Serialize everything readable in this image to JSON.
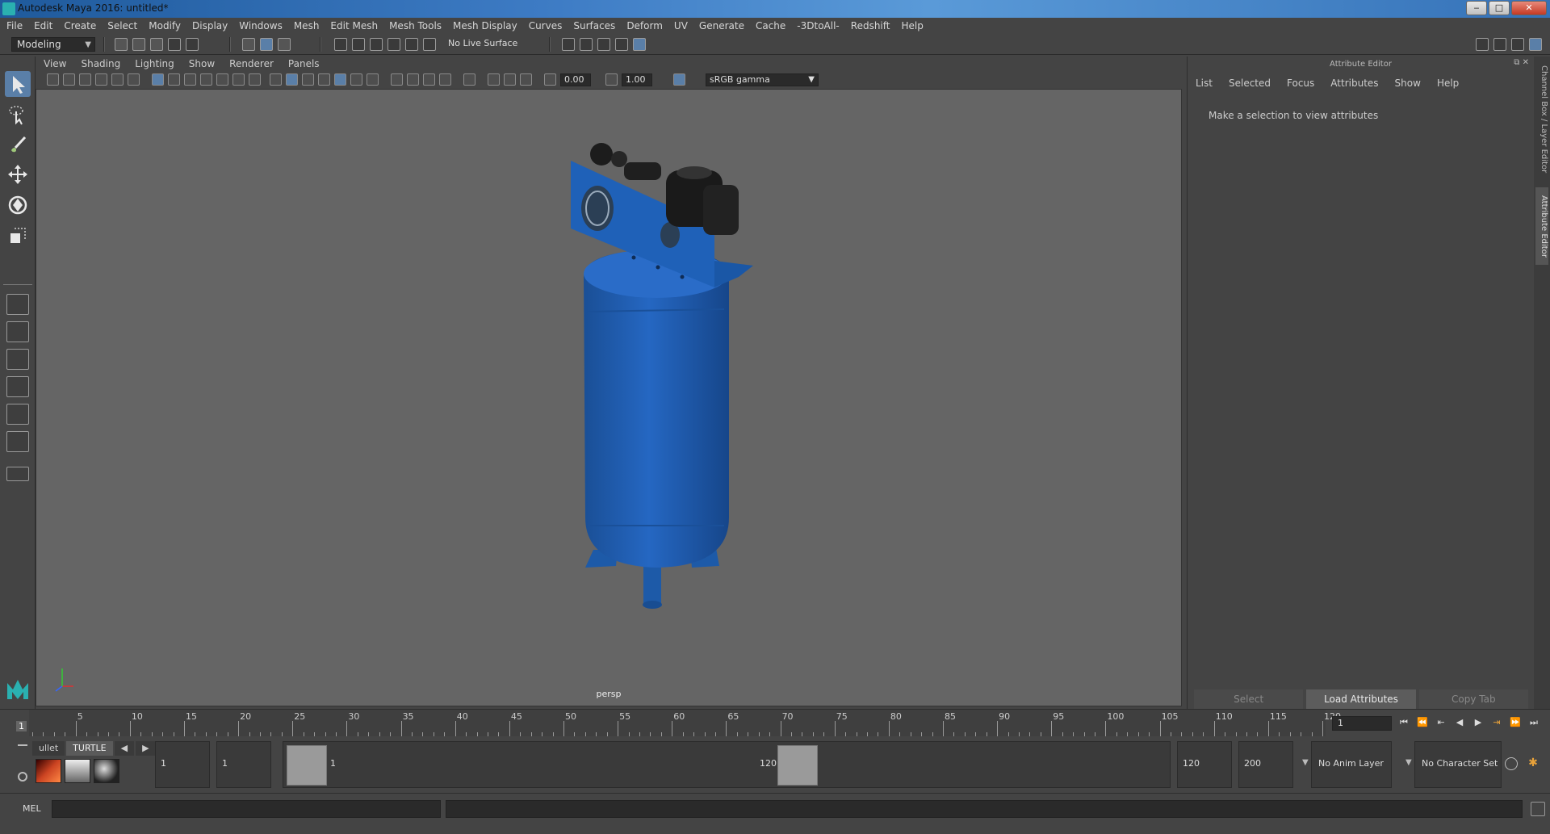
{
  "window": {
    "title": "Autodesk Maya 2016: untitled*",
    "controls": {
      "minimize": "‒",
      "maximize": "□",
      "close": "✕"
    }
  },
  "menubar": [
    "File",
    "Edit",
    "Create",
    "Select",
    "Modify",
    "Display",
    "Windows",
    "Mesh",
    "Edit Mesh",
    "Mesh Tools",
    "Mesh Display",
    "Curves",
    "Surfaces",
    "Deform",
    "UV",
    "Generate",
    "Cache",
    "-3DtoAll-",
    "Redshift",
    "Help"
  ],
  "status": {
    "mode": "Modeling",
    "live_surface": "No Live Surface"
  },
  "panel": {
    "menus": [
      "View",
      "Shading",
      "Lighting",
      "Show",
      "Renderer",
      "Panels"
    ],
    "exposure": "0.00",
    "gamma_value": "1.00",
    "color_space": "sRGB gamma",
    "camera_label": "persp"
  },
  "attribute_editor": {
    "title": "Attribute Editor",
    "menus": [
      "List",
      "Selected",
      "Focus",
      "Attributes",
      "Show",
      "Help"
    ],
    "message": "Make a selection to view attributes",
    "buttons": {
      "select": "Select",
      "load": "Load Attributes",
      "copy": "Copy Tab"
    },
    "side_tabs": {
      "channel_box": "Channel Box / Layer Editor",
      "attribute_editor": "Attribute Editor"
    }
  },
  "timeline": {
    "current_frame": "1",
    "ticks": [
      "5",
      "10",
      "15",
      "20",
      "25",
      "30",
      "35",
      "40",
      "45",
      "50",
      "55",
      "60",
      "65",
      "70",
      "75",
      "80",
      "85",
      "90",
      "95",
      "100",
      "105",
      "110",
      "115",
      "120"
    ],
    "frame_field": "1"
  },
  "shelf": {
    "tabs": [
      "ullet",
      "TURTLE"
    ]
  },
  "range": {
    "start_field": "1",
    "playback_start": "1",
    "handle_start_label": "1",
    "handle_end_label": "120",
    "playback_end": "120",
    "end_field": "200",
    "anim_layer": "No Anim Layer",
    "character_set": "No Character Set"
  },
  "command_line": {
    "label": "MEL"
  },
  "colors": {
    "tank": "#1f5fb0",
    "viewport_bg": "#656565",
    "accent": "#5a7fa8"
  }
}
